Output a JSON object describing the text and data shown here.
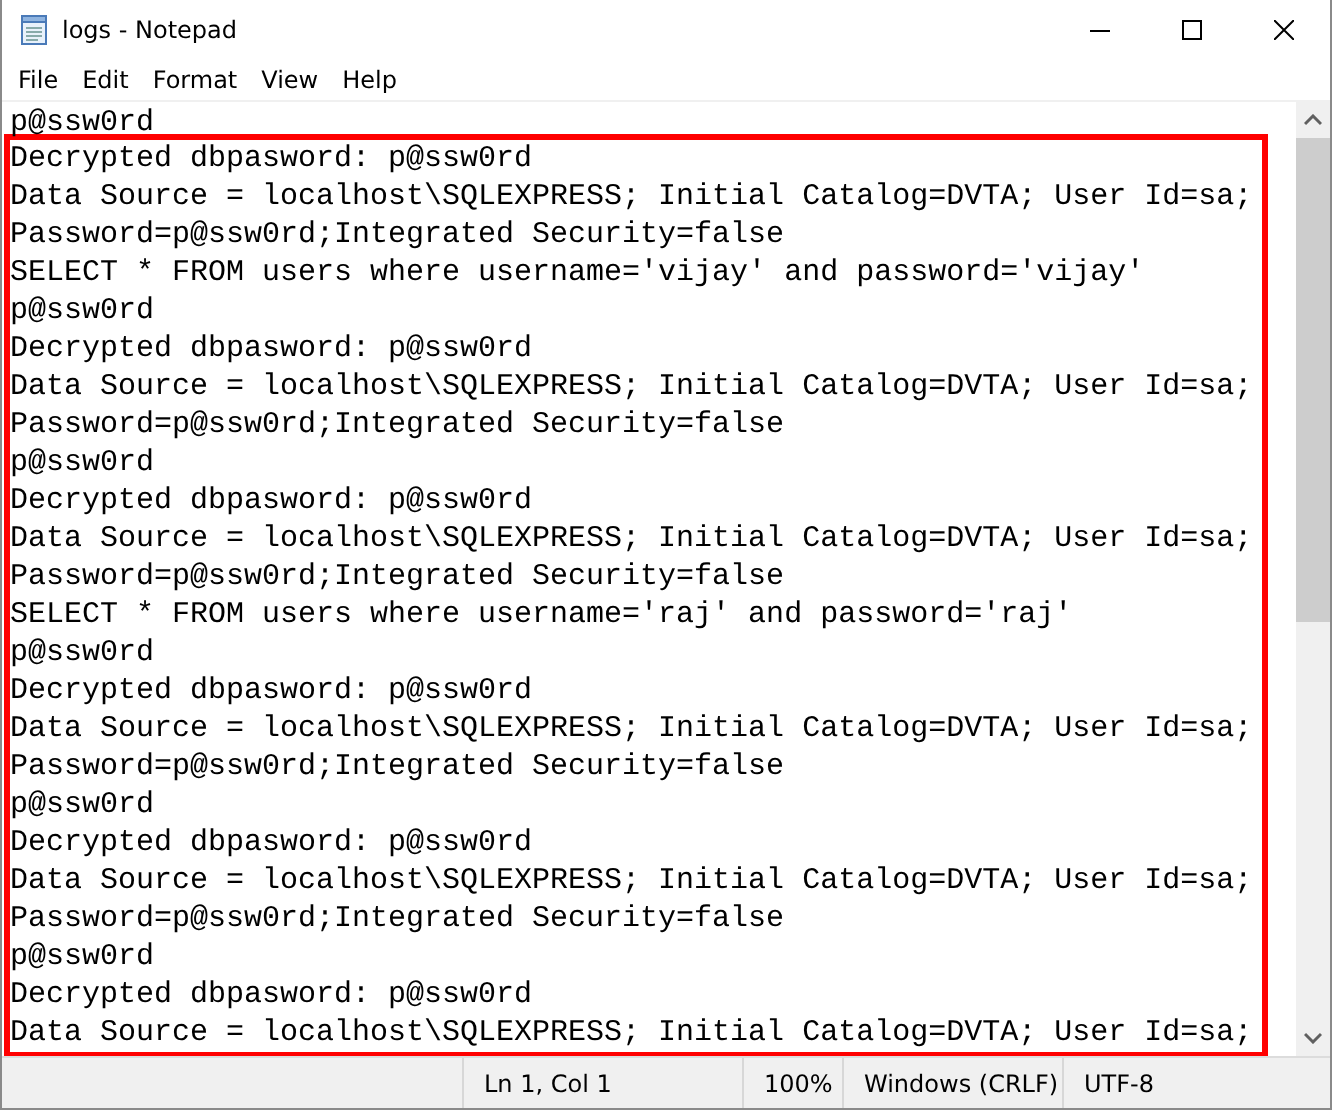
{
  "window": {
    "title": "logs - Notepad"
  },
  "menu": [
    "File",
    "Edit",
    "Format",
    "View",
    "Help"
  ],
  "editor": {
    "lines": [
      "p@ssw0rd"
    ],
    "highlighted_lines": [
      "Decrypted dbpasword: p@ssw0rd",
      "Data Source = localhost\\SQLEXPRESS; Initial Catalog=DVTA; User Id=sa;",
      "Password=p@ssw0rd;Integrated Security=false",
      "SELECT * FROM users where username='vijay' and password='vijay'",
      "p@ssw0rd",
      "Decrypted dbpasword: p@ssw0rd",
      "Data Source = localhost\\SQLEXPRESS; Initial Catalog=DVTA; User Id=sa;",
      "Password=p@ssw0rd;Integrated Security=false",
      "p@ssw0rd",
      "Decrypted dbpasword: p@ssw0rd",
      "Data Source = localhost\\SQLEXPRESS; Initial Catalog=DVTA; User Id=sa;",
      "Password=p@ssw0rd;Integrated Security=false",
      "SELECT * FROM users where username='raj' and password='raj'",
      "p@ssw0rd",
      "Decrypted dbpasword: p@ssw0rd",
      "Data Source = localhost\\SQLEXPRESS; Initial Catalog=DVTA; User Id=sa;",
      "Password=p@ssw0rd;Integrated Security=false",
      "p@ssw0rd",
      "Decrypted dbpasword: p@ssw0rd",
      "Data Source = localhost\\SQLEXPRESS; Initial Catalog=DVTA; User Id=sa;",
      "Password=p@ssw0rd;Integrated Security=false",
      "p@ssw0rd",
      "Decrypted dbpasword: p@ssw0rd",
      "Data Source = localhost\\SQLEXPRESS; Initial Catalog=DVTA; User Id=sa;"
    ]
  },
  "status_bar": {
    "position": "Ln 1, Col 1",
    "zoom": "100%",
    "line_endings": "Windows (CRLF)",
    "encoding": "UTF-8"
  }
}
